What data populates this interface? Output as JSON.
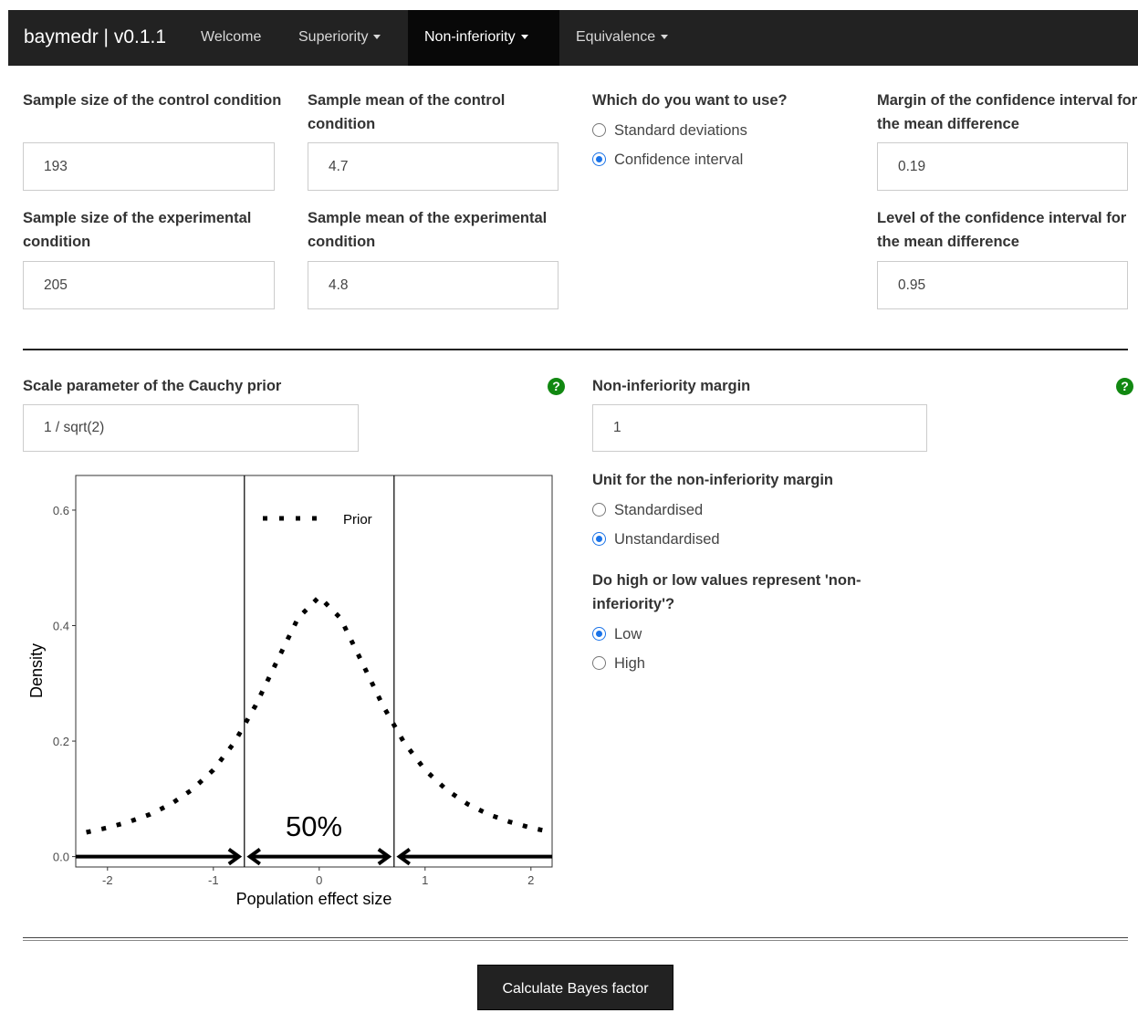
{
  "navbar": {
    "brand": "baymedr | v0.1.1",
    "items": [
      {
        "label": "Welcome",
        "dropdown": false,
        "active": false
      },
      {
        "label": "Superiority",
        "dropdown": true,
        "active": false
      },
      {
        "label": "Non-inferiority",
        "dropdown": true,
        "active": true
      },
      {
        "label": "Equivalence",
        "dropdown": true,
        "active": false
      }
    ]
  },
  "inputs": {
    "n_control": {
      "label": "Sample size of the control condition",
      "value": "193"
    },
    "mean_control": {
      "label": "Sample mean of the control condition",
      "value": "4.7"
    },
    "n_experimental": {
      "label": "Sample size of the experimental condition",
      "value": "205"
    },
    "mean_experimental": {
      "label": "Sample mean of the experimental condition",
      "value": "4.8"
    },
    "which_use": {
      "label": "Which do you want to use?",
      "options": [
        "Standard deviations",
        "Confidence interval"
      ],
      "selected": "Confidence interval"
    },
    "ci_margin": {
      "label": "Margin of the confidence interval for the mean difference",
      "value": "0.19"
    },
    "ci_level": {
      "label": "Level of the confidence interval for the mean difference",
      "value": "0.95"
    },
    "prior_scale": {
      "label": "Scale parameter of the Cauchy prior",
      "value": "1 / sqrt(2)"
    },
    "ni_margin": {
      "label": "Non-inferiority margin",
      "value": "1"
    },
    "ni_unit": {
      "label": "Unit for the non-inferiority margin",
      "options": [
        "Standardised",
        "Unstandardised"
      ],
      "selected": "Unstandardised"
    },
    "high_low": {
      "label": "Do high or low values represent 'non-inferiority'?",
      "options": [
        "Low",
        "High"
      ],
      "selected": "Low"
    }
  },
  "help_icon": "question-circle-icon",
  "help_color": "#118811",
  "accent_color": "#1a73e8",
  "button_label": "Calculate Bayes factor",
  "chart_data": {
    "type": "line",
    "series": [
      {
        "name": "Prior",
        "style": "dotted",
        "x": [
          -2.2,
          -2.0,
          -1.8,
          -1.6,
          -1.4,
          -1.2,
          -1.0,
          -0.8,
          -0.6,
          -0.4,
          -0.2,
          0.0,
          0.2,
          0.4,
          0.6,
          0.8,
          1.0,
          1.2,
          1.4,
          1.6,
          1.8,
          2.0,
          2.2
        ],
        "y": [
          0.042,
          0.05,
          0.06,
          0.073,
          0.091,
          0.116,
          0.15,
          0.198,
          0.262,
          0.338,
          0.413,
          0.45,
          0.413,
          0.338,
          0.262,
          0.198,
          0.15,
          0.116,
          0.091,
          0.073,
          0.06,
          0.05,
          0.042
        ]
      }
    ],
    "vlines": [
      -0.707,
      0.707
    ],
    "annotation": "50%",
    "xlabel": "Population effect size",
    "ylabel": "Density",
    "xticks": [
      "-2",
      "-1",
      "0",
      "1",
      "2"
    ],
    "yticks": [
      "0.0",
      "0.2",
      "0.4",
      "0.6"
    ],
    "xlim": [
      -2.3,
      2.2
    ],
    "ylim": [
      -0.018,
      0.66
    ],
    "legend": "top-center",
    "grid": false
  }
}
